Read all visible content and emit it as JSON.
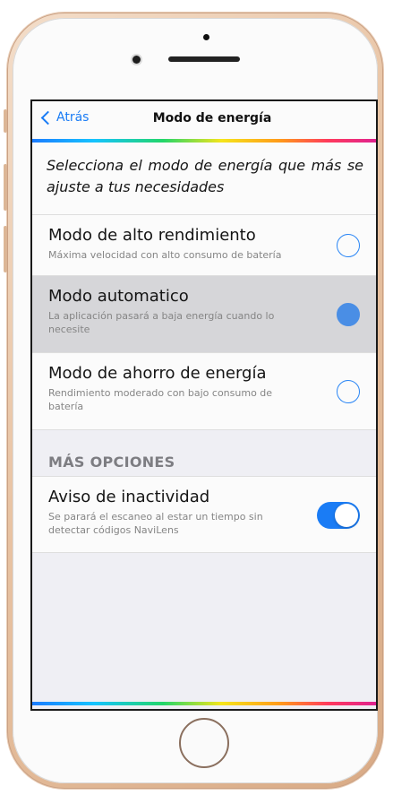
{
  "navbar": {
    "back_label": "Atrás",
    "title": "Modo de energía"
  },
  "intro": "Selecciona el modo de energía que más se ajuste a tus necesidades",
  "modes": [
    {
      "title": "Modo de alto rendimiento",
      "subtitle": "Máxima velocidad con alto consumo de batería",
      "selected": false
    },
    {
      "title": "Modo automatico",
      "subtitle": "La aplicación pasará a baja energía cuando lo necesite",
      "selected": true
    },
    {
      "title": "Modo de ahorro de energía",
      "subtitle": "Rendimiento moderado con bajo consumo de batería",
      "selected": false
    }
  ],
  "more_options": {
    "header": "MÁS OPCIONES",
    "inactivity": {
      "title": "Aviso de inactividad",
      "subtitle": "Se parará el escaneo al estar un tiempo sin detectar códigos NaviLens",
      "enabled": true
    }
  },
  "colors": {
    "accent": "#1a7cf5",
    "selected_row": "#d6d6d9",
    "radio_fill": "#4a8ee5"
  }
}
